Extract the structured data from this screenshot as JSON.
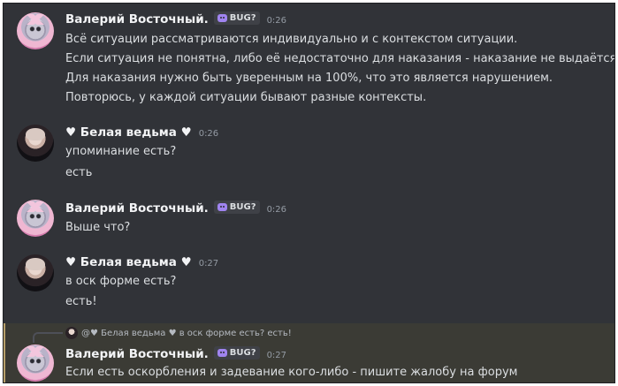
{
  "messages": [
    {
      "author": "Валерий Восточный.",
      "tag": "BUG?",
      "time": "0:26",
      "lines": [
        "Всё ситуации рассматриваются индивидуально и с контекстом ситуации.",
        "Если ситуация не понятна, либо её недостаточно для наказания - наказание не выдаётся.",
        "Для наказания нужно быть уверенным на 100%, что это является нарушением.",
        "Повторюсь, у каждой ситуации бывают разные контексты."
      ]
    },
    {
      "author": "♥ Белая ведьма ♥",
      "time": "0:26",
      "lines": [
        "упоминание есть?",
        "есть"
      ]
    },
    {
      "author": "Валерий Восточный.",
      "tag": "BUG?",
      "time": "0:26",
      "lines": [
        "Выше что?"
      ]
    },
    {
      "author": "♥ Белая ведьма ♥",
      "time": "0:27",
      "lines": [
        "в оск форме есть?",
        "есть!"
      ]
    },
    {
      "reply_to": "@♥ Белая ведьма ♥ в оск форме есть? есть!",
      "author": "Валерий Восточный.",
      "tag": "BUG?",
      "time": "0:27",
      "lines": [
        "Если есть оскорбления и задевание кого-либо - пишите жалобу на форум"
      ]
    }
  ],
  "colors": {
    "background": "#313338",
    "username": "#f2f3f5",
    "text": "#dbdee1",
    "timestamp": "#949ba4",
    "tag_icon": "#a084f0",
    "highlight": "#3b3b35"
  },
  "icons": {
    "avatar_1": "cat-avatar",
    "avatar_2": "witch-avatar",
    "tag_icon": "bot-face-icon"
  }
}
